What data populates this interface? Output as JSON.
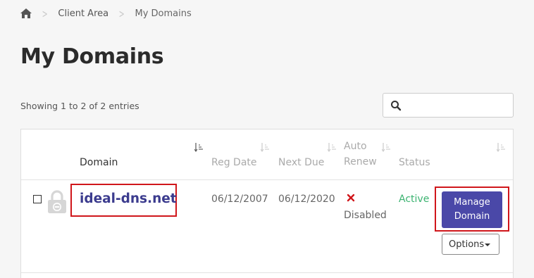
{
  "breadcrumb": {
    "home_icon": "home-icon",
    "items": [
      "Client Area",
      "My Domains"
    ]
  },
  "page": {
    "title": "My Domains",
    "showing_text": "Showing 1 to 2 of 2 entries"
  },
  "search": {
    "placeholder": "",
    "value": "",
    "icon": "search-icon"
  },
  "table": {
    "headers": {
      "domain": "Domain",
      "reg_date": "Reg Date",
      "next_due": "Next Due",
      "auto_renew_line1": "Auto",
      "auto_renew_line2": "Renew",
      "status": "Status"
    },
    "rows": [
      {
        "domain": "ideal-dns.net",
        "reg_date": "06/12/2007",
        "next_due": "06/12/2020",
        "auto_renew": "Disabled",
        "status": "Active",
        "manage_line1": "Manage",
        "manage_line2": "Domain",
        "options_label": "Options"
      }
    ]
  },
  "colors": {
    "accent": "#4a48a8",
    "domain_link": "#3b3b8e",
    "status_active": "#3cb371",
    "disabled_x": "#d0161b",
    "highlight_box": "#d0161b"
  }
}
